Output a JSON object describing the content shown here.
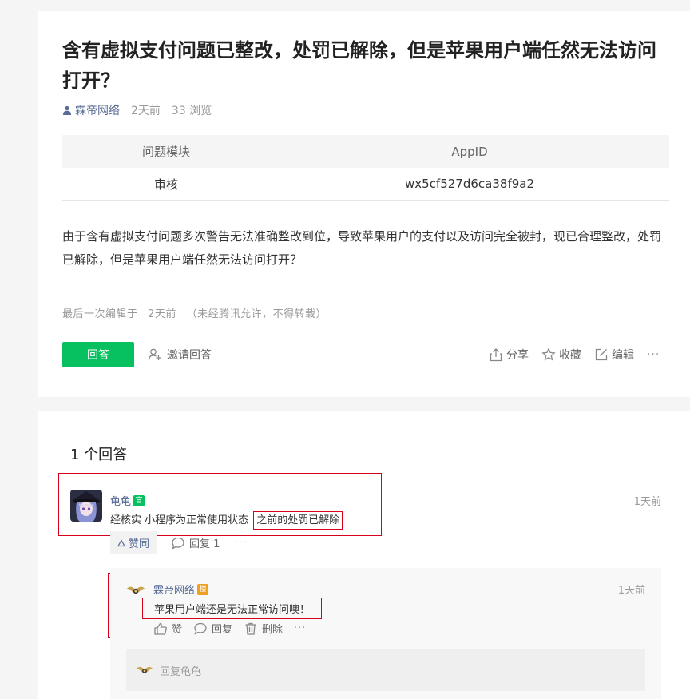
{
  "question": {
    "title": "含有虚拟支付问题已整改，处罚已解除，但是苹果用户端任然无法访问打开？",
    "author": "霖帝网络",
    "time": "2天前",
    "views": "33 浏览",
    "table": {
      "headers": [
        "问题模块",
        "AppID"
      ],
      "row": [
        "审核",
        "wx5cf527d6ca38f9a2"
      ]
    },
    "description": "由于含有虚拟支付问题多次警告无法准确整改到位，导致苹果用户的支付以及访问完全被封，现已合理整改，处罚已解除，但是苹果用户端任然无法访问打开？",
    "edit_info": {
      "label": "最后一次编辑于",
      "time": "2天前",
      "notice": "（未经腾讯允许，不得转载）"
    },
    "answer_button": "回答",
    "invite_label": "邀请回答",
    "actions": {
      "share": "分享",
      "favorite": "收藏",
      "edit": "编辑",
      "more": "···"
    }
  },
  "answers_section": {
    "count_label": "1 个回答",
    "answer": {
      "name": "龟龟",
      "badge": "官",
      "time": "1天前",
      "text_plain": "经核实 小程序为正常使用状态",
      "text_highlight": "之前的处罚已解除",
      "agree_label": "赞同",
      "reply_label": "回复 1",
      "more": "···"
    },
    "sub_reply": {
      "name": "霖帝网络",
      "badge": "楼",
      "time": "1天前",
      "text": "苹果用户端还是无法正常访问噢！",
      "like_label": "赞",
      "reply_label": "回复",
      "delete_label": "删除",
      "more": "···"
    },
    "reply_input": {
      "placeholder": "回复龟龟"
    }
  },
  "colors": {
    "accent_green": "#07c160",
    "link_blue": "#576b95",
    "annotation_red": "#d9001b",
    "floor_badge": "#f0a020"
  },
  "icons": [
    "user-icon",
    "invite-icon",
    "share-icon",
    "star-icon",
    "edit-icon",
    "thumb-up-icon",
    "comment-icon",
    "trash-icon",
    "wing-avatar-icon"
  ]
}
